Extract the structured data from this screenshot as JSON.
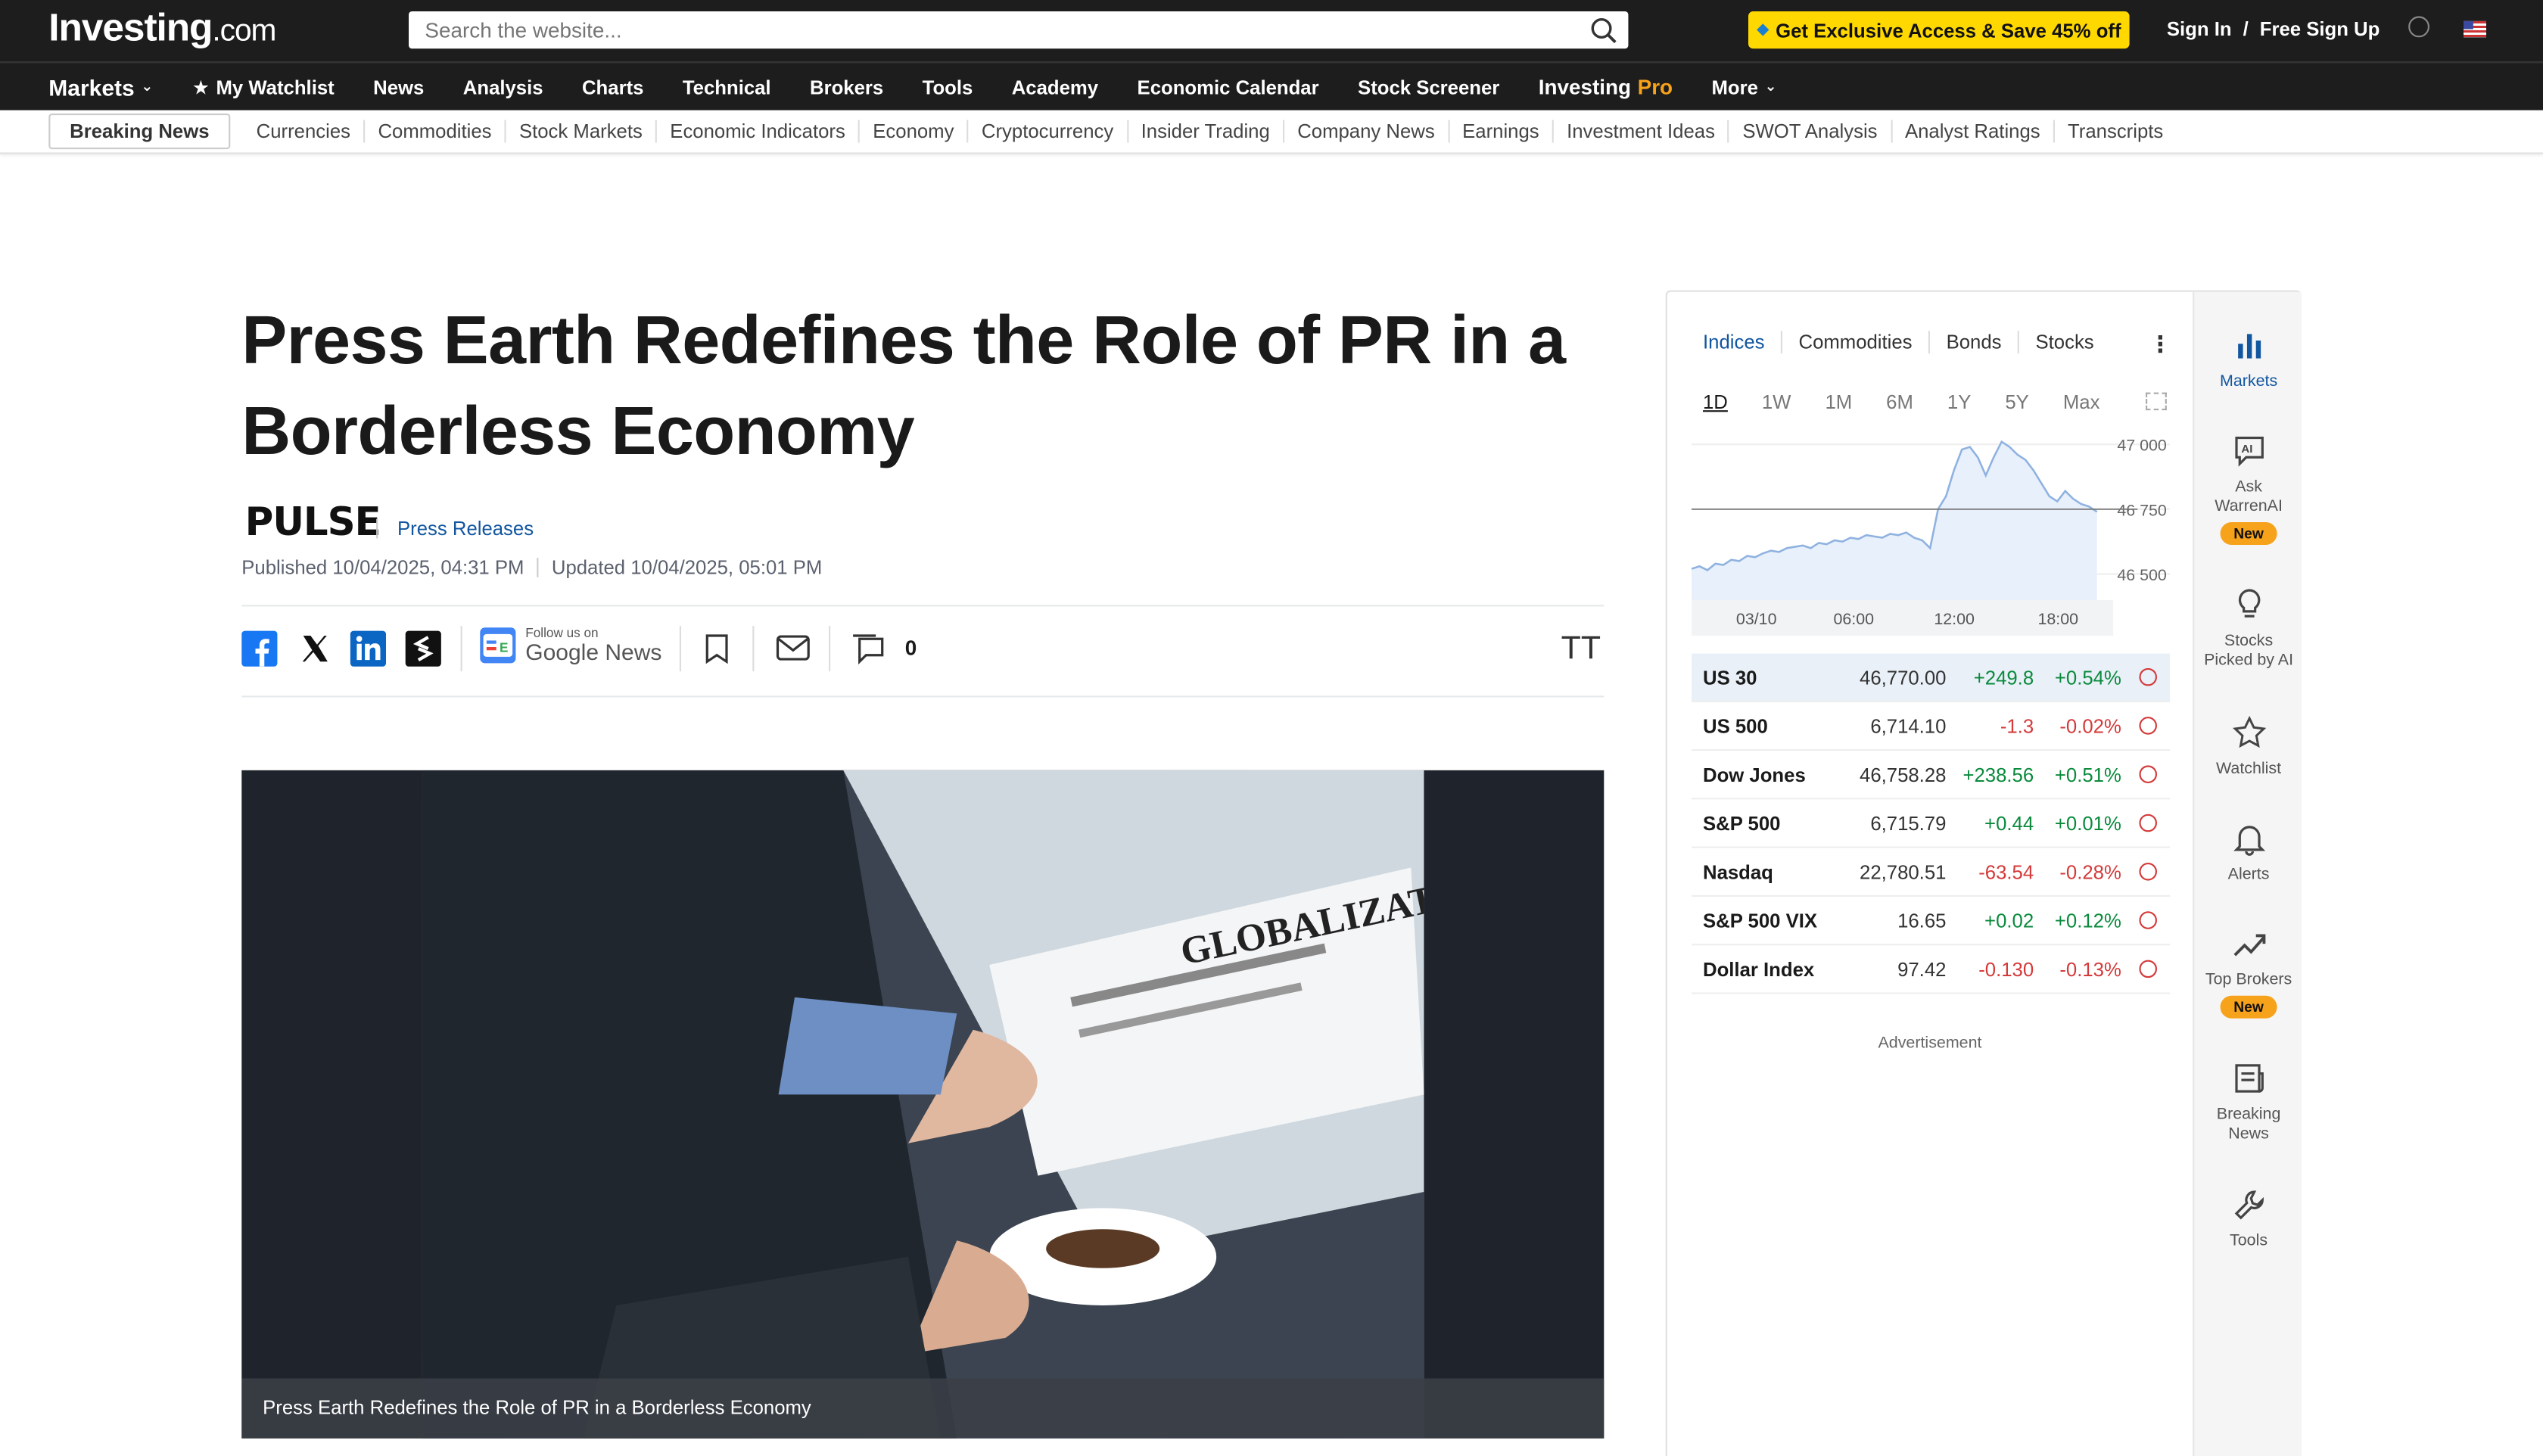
{
  "header": {
    "logo_main": "Investing",
    "logo_suffix": ".com",
    "search_placeholder": "Search the website...",
    "promo": "Get Exclusive Access & Save 45% off",
    "sign_in": "Sign In",
    "slash": "/",
    "sign_up": "Free Sign Up"
  },
  "nav": {
    "markets": "Markets",
    "items": [
      "My Watchlist",
      "News",
      "Analysis",
      "Charts",
      "Technical",
      "Brokers",
      "Tools",
      "Academy",
      "Economic Calendar",
      "Stock Screener"
    ],
    "pro_a": "Investing",
    "pro_b": "Pro",
    "more": "More"
  },
  "subnav": {
    "breaking": "Breaking News",
    "items": [
      "Currencies",
      "Commodities",
      "Stock Markets",
      "Economic Indicators",
      "Economy",
      "Cryptocurrency",
      "Insider Trading",
      "Company News",
      "Earnings",
      "Investment Ideas",
      "SWOT Analysis",
      "Analyst Ratings",
      "Transcripts"
    ]
  },
  "article": {
    "title": "Press Earth Redefines the Role of PR in a Borderless Economy",
    "source_logo": "PULSE",
    "category": "Press Releases",
    "published": "Published 10/04/2025, 04:31 PM",
    "updated": "Updated 10/04/2025, 05:01 PM",
    "follow_small": "Follow us on",
    "follow_big": "Google News",
    "comment_count": "0",
    "font_size_label": "TT",
    "image_caption": "Press Earth Redefines the Role of PR in a Borderless Economy",
    "image_headline": "GLOBALIZATION"
  },
  "widget": {
    "tabs": [
      "Indices",
      "Commodities",
      "Bonds",
      "Stocks"
    ],
    "periods": [
      "1D",
      "1W",
      "1M",
      "6M",
      "1Y",
      "5Y",
      "Max"
    ],
    "active_period": "1D",
    "chart_data": {
      "type": "area",
      "x_labels": [
        "03/10",
        "06:00",
        "12:00",
        "18:00"
      ],
      "y_labels": [
        "47 000",
        "46 750",
        "46 500"
      ],
      "ylim": [
        46400,
        47050
      ],
      "reference_line": 46750,
      "values": [
        46520,
        46530,
        46515,
        46540,
        46535,
        46555,
        46550,
        46570,
        46565,
        46580,
        46590,
        46585,
        46600,
        46605,
        46610,
        46600,
        46620,
        46615,
        46630,
        46625,
        46640,
        46635,
        46650,
        46645,
        46640,
        46655,
        46650,
        46660,
        46640,
        46630,
        46600,
        46750,
        46800,
        46900,
        46980,
        46990,
        46950,
        46880,
        46950,
        47010,
        46990,
        46960,
        46940,
        46900,
        46850,
        46800,
        46780,
        46820,
        46790,
        46770,
        46760,
        46740
      ]
    },
    "quotes": [
      {
        "name": "US 30",
        "price": "46,770.00",
        "change": "+249.8",
        "pct": "+0.54%",
        "dir": "up"
      },
      {
        "name": "US 500",
        "price": "6,714.10",
        "change": "-1.3",
        "pct": "-0.02%",
        "dir": "dn"
      },
      {
        "name": "Dow Jones",
        "price": "46,758.28",
        "change": "+238.56",
        "pct": "+0.51%",
        "dir": "up"
      },
      {
        "name": "S&P 500",
        "price": "6,715.79",
        "change": "+0.44",
        "pct": "+0.01%",
        "dir": "up"
      },
      {
        "name": "Nasdaq",
        "price": "22,780.51",
        "change": "-63.54",
        "pct": "-0.28%",
        "dir": "dn"
      },
      {
        "name": "S&P 500 VIX",
        "price": "16.65",
        "change": "+0.02",
        "pct": "+0.12%",
        "dir": "up"
      },
      {
        "name": "Dollar Index",
        "price": "97.42",
        "change": "-0.130",
        "pct": "-0.13%",
        "dir": "dn"
      }
    ],
    "advertisement": "Advertisement"
  },
  "rail": {
    "markets": "Markets",
    "ask_a": "Ask",
    "ask_b": "WarrenAI",
    "new": "New",
    "stocks_a": "Stocks",
    "stocks_b": "Picked by AI",
    "watchlist": "Watchlist",
    "alerts": "Alerts",
    "brokers": "Top Brokers",
    "breaking_a": "Breaking",
    "breaking_b": "News",
    "tools": "Tools"
  },
  "colors": {
    "up": "#0a8a3c",
    "down": "#d43a3a",
    "link": "#1256a0",
    "promo": "#ffd800",
    "pro_accent": "#f7a21b"
  }
}
